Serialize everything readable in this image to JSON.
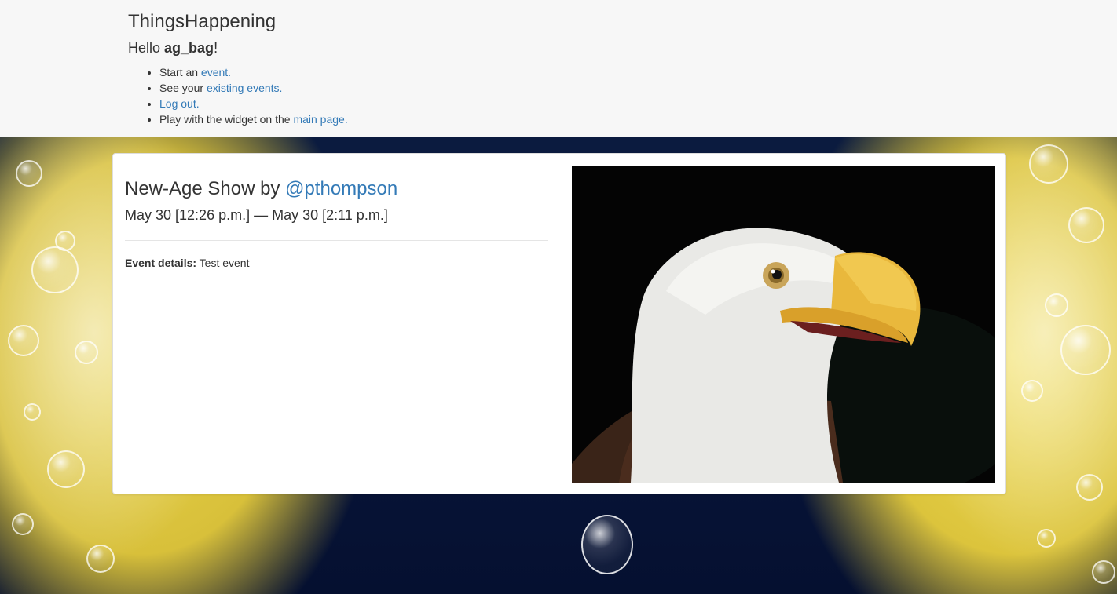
{
  "header": {
    "site_title": "ThingsHappening",
    "greeting_prefix": "Hello ",
    "username": "ag_bag",
    "greeting_suffix": "!",
    "nav": [
      {
        "prefix": "Start an ",
        "link": "event."
      },
      {
        "prefix": "See your ",
        "link": "existing events."
      },
      {
        "prefix": "",
        "link": "Log out."
      },
      {
        "prefix": "Play with the widget on the ",
        "link": "main page."
      }
    ]
  },
  "event": {
    "title_prefix": "New-Age Show by ",
    "host_link": "@pthompson",
    "time_range": "May 30 [12:26 p.m.] — May 30 [2:11 p.m.]",
    "details_label": "Event details:",
    "details_value": " Test event",
    "image_alt": "bald-eagle-photo"
  },
  "colors": {
    "link": "#337ab7",
    "header_bg": "#f7f7f7",
    "text": "#333333"
  }
}
